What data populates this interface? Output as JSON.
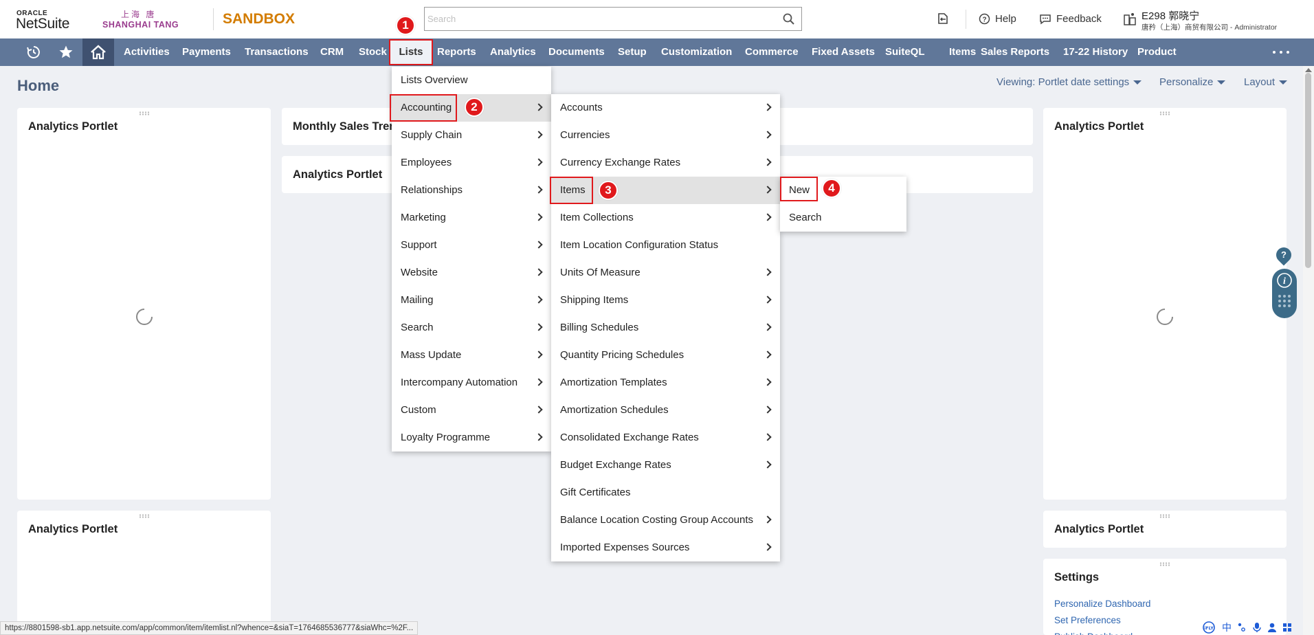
{
  "header": {
    "oracle": "ORACLE",
    "netsuite": "NetSuite",
    "company_cn": "上海 唐",
    "company_en": "SHANGHAI TANG",
    "environment": "SANDBOX",
    "search_placeholder": "Search",
    "help_label": "Help",
    "feedback_label": "Feedback",
    "user_name": "E298 郭晓宁",
    "user_role": "唐矜（上海）商贸有限公司 - Administrator"
  },
  "nav": {
    "items": [
      "Activities",
      "Payments",
      "Transactions",
      "CRM",
      "Stock",
      "Lists",
      "Reports",
      "Analytics",
      "Documents",
      "Setup",
      "Customization",
      "Commerce",
      "Fixed Assets",
      "SuiteQL",
      "Items",
      "Sales Reports",
      "17-22 History",
      "Product"
    ]
  },
  "page": {
    "title": "Home",
    "viewing": "Viewing: Portlet date settings",
    "personalize": "Personalize",
    "layout": "Layout"
  },
  "portlets": {
    "left_top": "Analytics Portlet",
    "left_bottom": "Analytics Portlet",
    "center_top": "Monthly Sales Trend",
    "center_second": "Analytics Portlet",
    "right_top": "Analytics Portlet",
    "right_middle": "Analytics Portlet",
    "settings_title": "Settings",
    "settings_links": [
      "Personalize Dashboard",
      "Set Preferences",
      "Publish Dashboard"
    ]
  },
  "menus": {
    "lists": [
      "Lists Overview",
      "Accounting",
      "Supply Chain",
      "Employees",
      "Relationships",
      "Marketing",
      "Support",
      "Website",
      "Mailing",
      "Search",
      "Mass Update",
      "Intercompany Automation",
      "Custom",
      "Loyalty Programme"
    ],
    "accounting": [
      "Accounts",
      "Currencies",
      "Currency Exchange Rates",
      "Items",
      "Item Collections",
      "Item Location Configuration Status",
      "Units Of Measure",
      "Shipping Items",
      "Billing Schedules",
      "Quantity Pricing Schedules",
      "Amortization Templates",
      "Amortization Schedules",
      "Consolidated Exchange Rates",
      "Budget Exchange Rates",
      "Gift Certificates",
      "Balance Location Costing Group Accounts",
      "Imported Expenses Sources"
    ],
    "items": [
      "New",
      "Search"
    ]
  },
  "steps": [
    "1",
    "2",
    "3",
    "4"
  ],
  "status": {
    "url": "https://8801598-sb1.app.netsuite.com/app/common/item/itemlist.nl?whence=&siaT=1764685536777&siaWhc=%2F..."
  },
  "ime": {
    "label": "中"
  },
  "colors": {
    "nav_bg": "#607799",
    "highlight": "#e0191c",
    "brand_purple": "#9a3c8e",
    "sandbox_orange": "#d37c00",
    "link_blue": "#2f66b0"
  }
}
